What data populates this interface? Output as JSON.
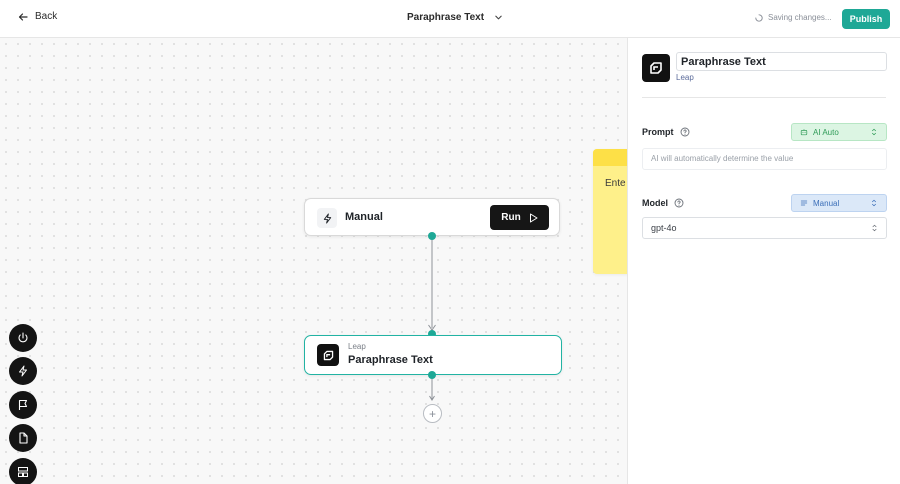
{
  "header": {
    "back_label": "Back",
    "flow_title": "Paraphrase Text",
    "saving_status": "Saving changes...",
    "publish_label": "Publish"
  },
  "canvas": {
    "trigger_node": {
      "label": "Manual",
      "run_label": "Run"
    },
    "action_node": {
      "app": "Leap",
      "label": "Paraphrase Text"
    },
    "sticky_note": {
      "text": "Ente sele then the t"
    },
    "toolbar": [
      "power-icon",
      "bolt-icon",
      "flag-icon",
      "file-icon",
      "layout-icon"
    ]
  },
  "panel": {
    "step_name": "Paraphrase Text",
    "app_name": "Leap",
    "prompt": {
      "label": "Prompt",
      "mode": "AI Auto",
      "placeholder": "AI will automatically determine the value"
    },
    "model": {
      "label": "Model",
      "mode": "Manual",
      "value": "gpt-4o"
    }
  },
  "colors": {
    "accent": "#1ea896",
    "ai_pill_bg": "#dcf5e3",
    "manual_pill_bg": "#dbe8f8",
    "sticky_yellow": "#fef08a"
  }
}
